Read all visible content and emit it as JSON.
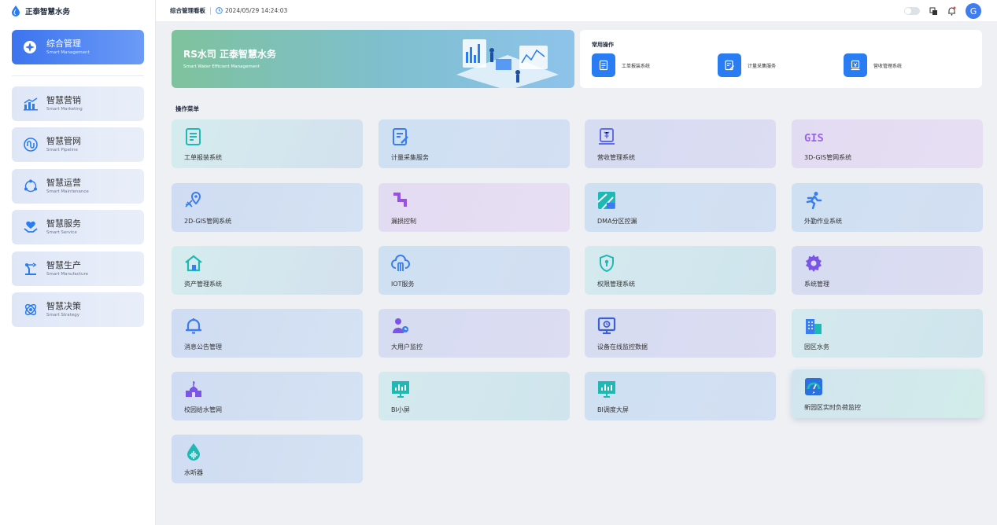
{
  "brand": {
    "name": "正泰智慧水务"
  },
  "sidebar": {
    "active": {
      "zh": "综合管理",
      "en": "Smart Management"
    },
    "items": [
      {
        "zh": "智慧营销",
        "en": "Smart Marketing",
        "icon": "bar-chart-icon"
      },
      {
        "zh": "智慧管网",
        "en": "Smart Pipeline",
        "icon": "pipeline-icon"
      },
      {
        "zh": "智慧运营",
        "en": "Smart Maintenance",
        "icon": "network-icon"
      },
      {
        "zh": "智慧服务",
        "en": "Smart Service",
        "icon": "heart-hand-icon"
      },
      {
        "zh": "智慧生产",
        "en": "Smart Manufacture",
        "icon": "robot-arm-icon"
      },
      {
        "zh": "智慧决策",
        "en": "Smart Strategy",
        "icon": "atom-icon"
      }
    ]
  },
  "topbar": {
    "title": "综合管理看板",
    "time": "2024/05/29 14:24:03",
    "avatar": "G"
  },
  "banner": {
    "title": "RS水司 正泰智慧水务",
    "subtitle": "Smart Water Efficient Management"
  },
  "quick": {
    "title": "常用操作",
    "items": [
      "工单报装系统",
      "计量采集服务",
      "营收管理系统"
    ]
  },
  "menu": {
    "title": "操作菜单",
    "cards": [
      "工单报装系统",
      "计量采集服务",
      "营收管理系统",
      "3D-GIS管网系统",
      "2D-GIS管网系统",
      "漏损控制",
      "DMA分区控漏",
      "外勤作业系统",
      "资产管理系统",
      "IOT服务",
      "权限管理系统",
      "系统管理",
      "消息公告管理",
      "大用户监控",
      "设备在线监控数据",
      "园区水务",
      "校园给水管网",
      "BI小屏",
      "BI调度大屏",
      "新园区实时负荷监控",
      "水听器"
    ],
    "gis_text": "GIS"
  },
  "colors": {
    "accent": "#3c74ef",
    "quick_icon": "#2a7cf2",
    "icon_blue": "#3a7df0",
    "icon_purple": "#8a63e8",
    "icon_teal": "#1eb8b5"
  }
}
